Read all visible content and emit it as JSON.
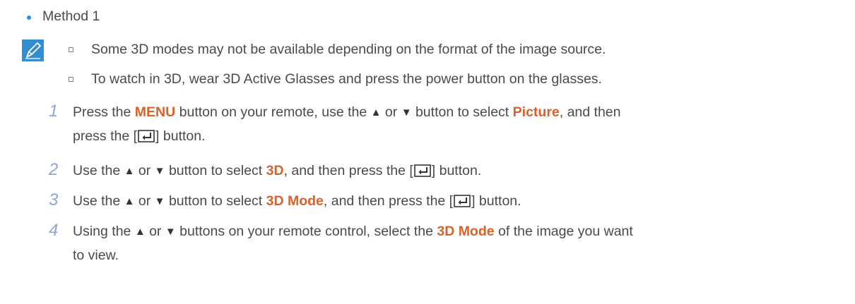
{
  "heading": {
    "label": "Method 1"
  },
  "notes": [
    "Some 3D modes may not be available depending on the format of the image source.",
    "To watch in 3D, wear 3D Active Glasses and press the power button on the glasses."
  ],
  "glyphs": {
    "up": "▲",
    "down": "▼"
  },
  "icons": {
    "bullet": "blue-dot",
    "note": "note-pencil-icon",
    "sub_bullet": "hollow-square",
    "enter": "enter-key-icon"
  },
  "colors": {
    "accent_blue": "#2f8fd0",
    "highlight_orange": "#d9612a",
    "step_number": "#8fa4d8",
    "body_text": "#4a4a4a"
  },
  "steps": [
    {
      "number": "1",
      "t1": "Press the ",
      "menu": "MENU",
      "t2": " button on your remote, use the ",
      "t3": " or ",
      "t4": " button to select ",
      "picture": "Picture",
      "t5": ", and then",
      "l2a": "press the [",
      "l2b": "] button."
    },
    {
      "number": "2",
      "t1": "Use the ",
      "t2": " or ",
      "t3": " button to select ",
      "target": "3D",
      "t4": ", and then press the [",
      "t5": "] button."
    },
    {
      "number": "3",
      "t1": "Use the ",
      "t2": " or ",
      "t3": " button to select ",
      "target": "3D Mode",
      "t4": ", and then press the [",
      "t5": "] button."
    },
    {
      "number": "4",
      "t1": "Using the ",
      "t2": " or ",
      "t3": " buttons on your remote control, select the ",
      "target": "3D Mode",
      "t4": " of the image you want",
      "l2": "to view."
    }
  ]
}
